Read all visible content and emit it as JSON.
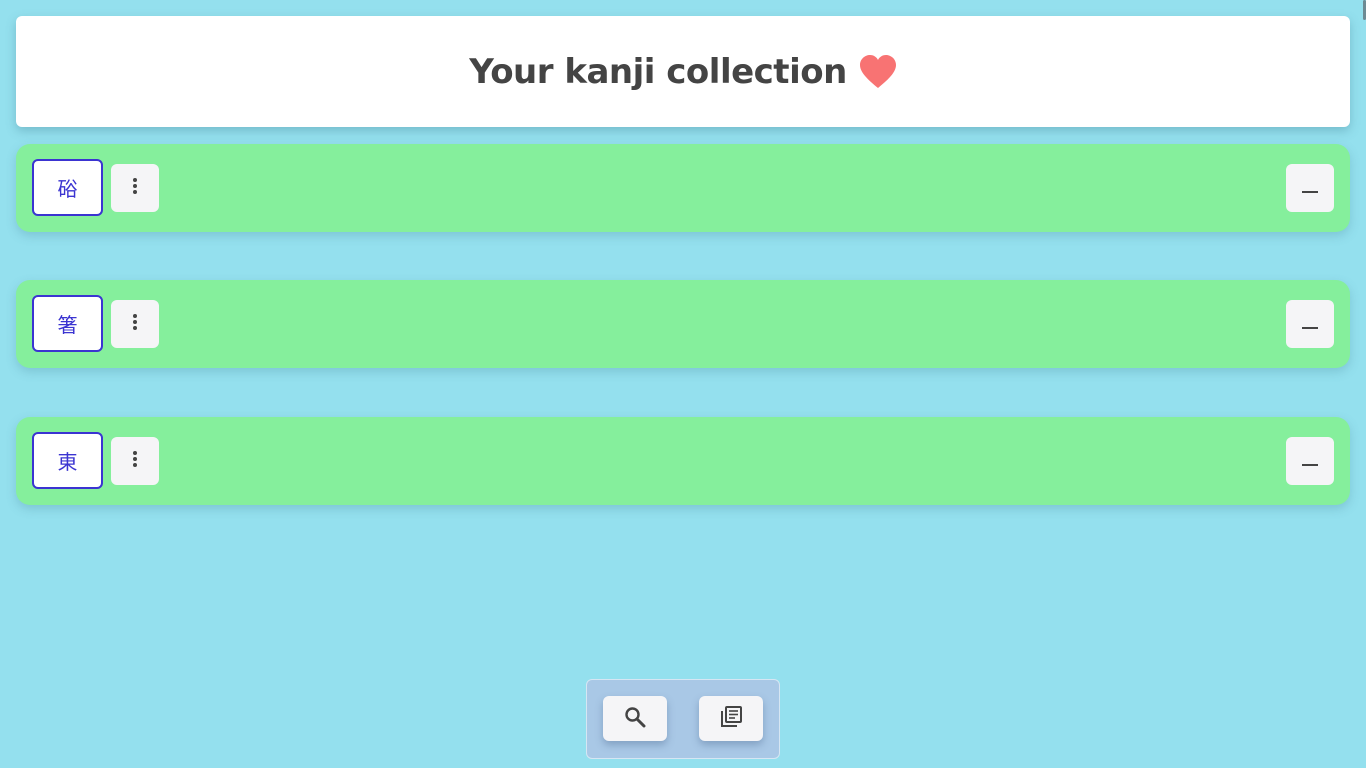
{
  "header": {
    "title": "Your kanji collection",
    "title_icon": "heart-icon",
    "heart_color": "#f87373"
  },
  "collection": {
    "row_color": "#85ef9c",
    "kanji_color": "#3b34d1",
    "items": [
      {
        "kanji": "硲",
        "menu_icon": "more-vertical-icon",
        "remove_icon": "minus-icon"
      },
      {
        "kanji": "箸",
        "menu_icon": "more-vertical-icon",
        "remove_icon": "minus-icon"
      },
      {
        "kanji": "東",
        "menu_icon": "more-vertical-icon",
        "remove_icon": "minus-icon"
      }
    ]
  },
  "bottom_bar": {
    "buttons": [
      {
        "icon": "search-icon"
      },
      {
        "icon": "library-books-icon"
      }
    ]
  },
  "colors": {
    "background": "#94e0ee",
    "card": "#ffffff",
    "button": "#f5f5f7"
  }
}
